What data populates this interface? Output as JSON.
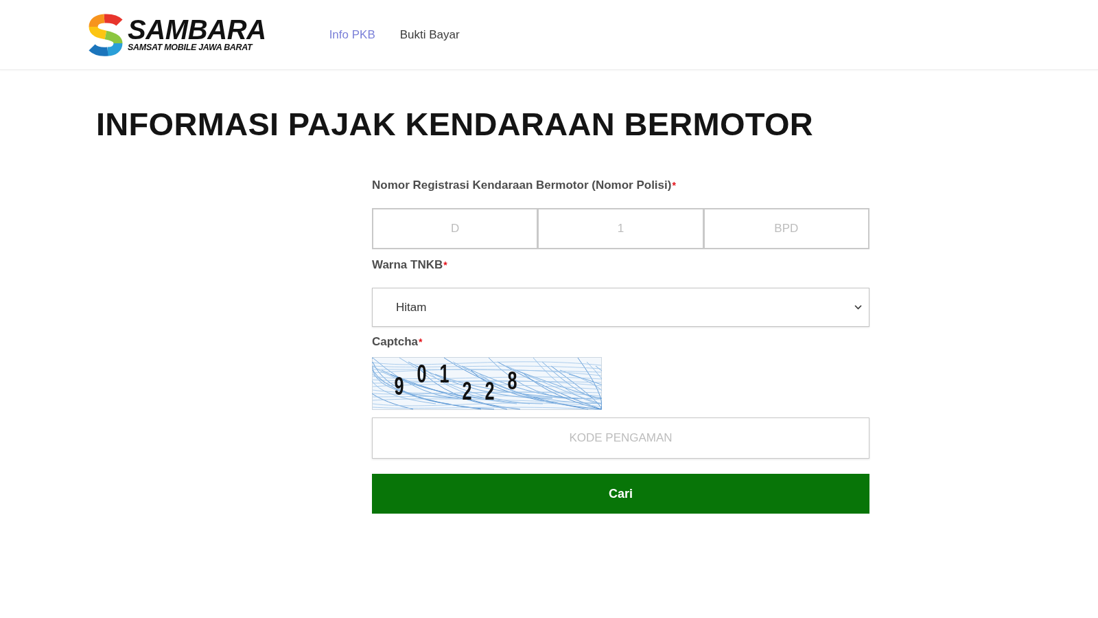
{
  "header": {
    "logo": {
      "name": "SAMBARA",
      "tagline": "SAMSAT MOBILE JAWA BARAT"
    },
    "nav": [
      {
        "label": "Info PKB",
        "selected": true
      },
      {
        "label": "Bukti Bayar",
        "selected": false
      }
    ]
  },
  "page_title": "INFORMASI PAJAK KENDARAAN BERMOTOR",
  "form": {
    "plate": {
      "label": "Nomor Registrasi Kendaraan Bermotor (Nomor Polisi)",
      "mark": "*",
      "fields": [
        {
          "placeholder": "D"
        },
        {
          "placeholder": "1"
        },
        {
          "placeholder": "BPD"
        }
      ]
    },
    "plate_color": {
      "label": "Warna TNKB",
      "mark": "*",
      "value": "Hitam"
    },
    "captcha": {
      "label": "Captcha",
      "mark": "*",
      "characters": [
        "9",
        "0",
        "1",
        "2",
        "2",
        "8"
      ],
      "placeholder": "KODE PENGAMAN"
    },
    "submit": {
      "label": "Cari"
    }
  }
}
